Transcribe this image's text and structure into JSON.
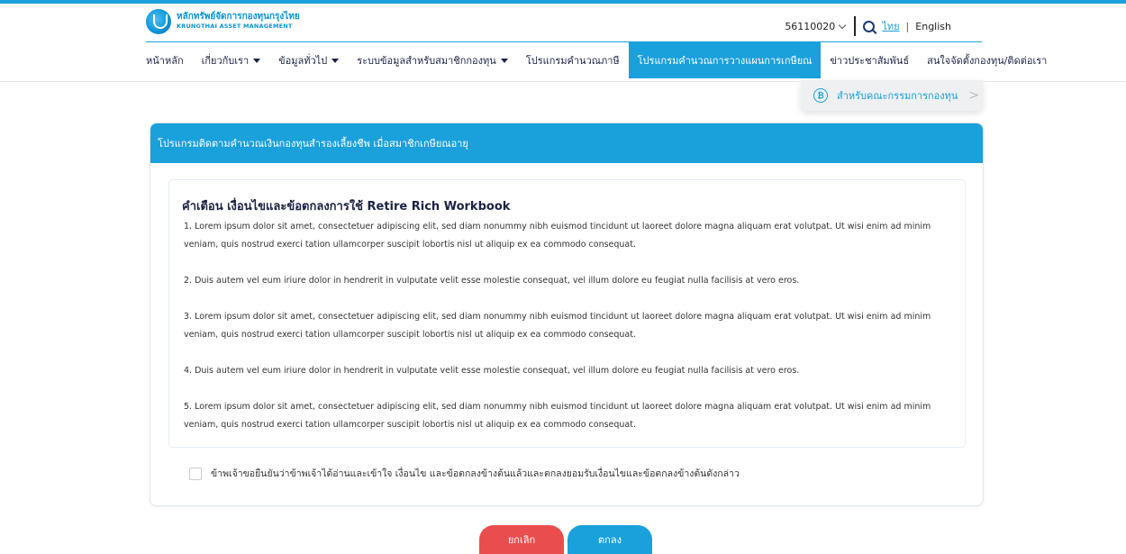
{
  "brand": {
    "name_th": "หลักทรัพย์จัดการกองทุนกรุงไทย",
    "name_en": "KRUNGTHAI ASSET MANAGEMENT"
  },
  "utility": {
    "account": "56110020",
    "lang_th": "ไทย",
    "lang_sep": "|",
    "lang_en": "English"
  },
  "nav": {
    "items": [
      {
        "label": "หน้าหลัก"
      },
      {
        "label": "เกี่ยวกับเรา"
      },
      {
        "label": "ข้อมูลทั่วไป"
      },
      {
        "label": "ระบบข้อมูลสำหรับสมาชิกกองทุน"
      },
      {
        "label": "โปรแกรมคำนวณภาษี"
      },
      {
        "label": "โปรแกรมคำนวณการวางแผนการเกษียณ"
      },
      {
        "label": "ข่าวประชาสัมพันธ์"
      },
      {
        "label": "สนใจจัดตั้งกองทุน/ติดต่อเรา"
      }
    ],
    "active_index": 5
  },
  "committee_button": {
    "icon": "committee-icon",
    "label": "สำหรับคณะกรรมการกองทุน"
  },
  "card": {
    "header": "โปรแกรมติดตามคำนวณเงินกองทุนสำรองเลี้ยงชีพ เมื่อสมาชิกเกษียณอายุ",
    "terms_title": "คำเตือน เงื่อนไขและข้อตกลงการใช้ Retire Rich Workbook",
    "paragraphs": [
      "1. Lorem ipsum dolor sit amet, consectetuer adipiscing elit, sed diam nonummy nibh euismod tincidunt ut laoreet dolore magna aliquam erat volutpat. Ut wisi enim ad minim veniam, quis nostrud exerci tation ullamcorper suscipit lobortis nisl ut aliquip ex ea commodo consequat.",
      "2. Duis autem vel eum iriure dolor in hendrerit in vulputate velit esse molestie consequat, vel illum dolore eu feugiat nulla facilisis at vero eros.",
      "3. Lorem ipsum dolor sit amet, consectetuer adipiscing elit, sed diam nonummy nibh euismod tincidunt ut laoreet dolore magna aliquam erat volutpat. Ut wisi enim ad minim veniam, quis nostrud exerci tation ullamcorper suscipit lobortis nisl ut aliquip ex ea commodo consequat.",
      "4. Duis autem vel eum iriure dolor in hendrerit in vulputate velit esse molestie consequat, vel illum dolore eu feugiat nulla facilisis at vero eros.",
      "5. Lorem ipsum dolor sit amet, consectetuer adipiscing elit, sed diam nonummy nibh euismod tincidunt ut laoreet dolore magna aliquam erat volutpat. Ut wisi enim ad minim veniam, quis nostrud exerci tation ullamcorper suscipit lobortis nisl ut aliquip ex ea commodo consequat."
    ],
    "consent_text": "ข้าพเจ้าขอยืนยันว่าข้าพเจ้าได้อ่านและเข้าใจ เงื่อนไข และข้อตกลงข้างต้นแล้วและตกลงยอมรับเงื่อนไขและข้อตกลงข้างต้นดังกล่าว",
    "consent_checked": false
  },
  "actions": {
    "cancel_label": "ยกเลิก",
    "ok_label": "ตกลง"
  },
  "colors": {
    "primary": "#1aa0db",
    "danger": "#ea4d4d",
    "nav_text": "#1b2244"
  }
}
